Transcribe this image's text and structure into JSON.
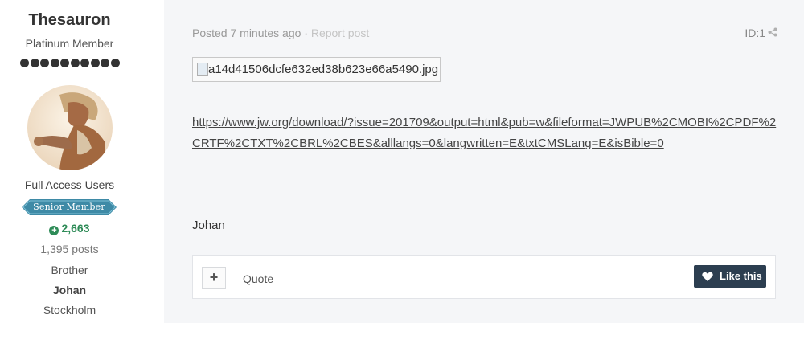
{
  "author": {
    "name": "Thesauron",
    "rank_title": "Platinum Member",
    "rank_pips": 10,
    "group": "Full Access Users",
    "badge_text": "Senior Member",
    "reputation": "2,663",
    "post_count": "1,395 posts",
    "field_a": "Brother",
    "field_b": "Johan",
    "field_c": "Stockholm"
  },
  "post": {
    "posted": "Posted 7 minutes ago",
    "separator": " · ",
    "report": "Report post",
    "id_label": "ID:1",
    "image_alt": "a14d41506dcfe632ed38b623e66a5490.jpg",
    "link": "https://www.jw.org/download/?issue=201709&output=html&pub=w&fileformat=JWPUB%2CMOBI%2CPDF%2CRTF%2CTXT%2CBRL%2CBES&alllangs=0&langwritten=E&txtCMSLang=E&isBible=0",
    "signature": "Johan"
  },
  "footer": {
    "add_symbol": "+",
    "quote_label": "Quote",
    "like_label": "Like this"
  },
  "colors": {
    "like_button": "#2c3e50",
    "reputation": "#2e8b57",
    "badge": "#3e8aa6",
    "post_background": "#f5f6f8"
  },
  "icons": [
    "plus-icon",
    "heart-icon",
    "share-icon",
    "broken-image-icon",
    "reputation-plus-icon"
  ]
}
